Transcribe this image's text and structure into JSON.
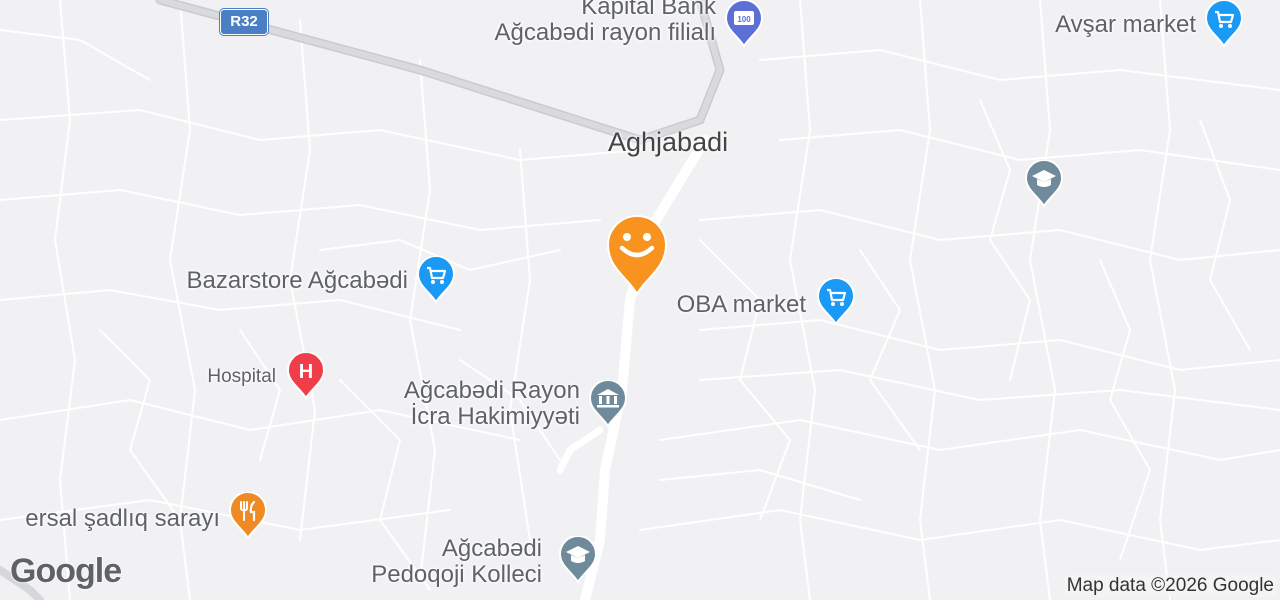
{
  "map": {
    "city_label": "Aghjabadi",
    "road_shield": "R32",
    "attribution": "Map data ©2026 Google",
    "logo": "Google",
    "places": [
      {
        "id": "kapital",
        "lines": [
          "Kapital Bank",
          "Ağcabədi rayon filialı"
        ],
        "icon": "atm-icon",
        "color": "#5b6fd6"
      },
      {
        "id": "avsar",
        "lines": [
          "Avşar market"
        ],
        "icon": "shopping-cart-icon",
        "color": "#1a9af5"
      },
      {
        "id": "bazarstore",
        "lines": [
          "Bazarstore Ağcabədi"
        ],
        "icon": "shopping-cart-icon",
        "color": "#1a9af5"
      },
      {
        "id": "oba",
        "lines": [
          "OBA market"
        ],
        "icon": "shopping-cart-icon",
        "color": "#1a9af5"
      },
      {
        "id": "hospital",
        "lines": [
          "Hospital"
        ],
        "icon": "hospital-icon",
        "color": "#ef3e4a"
      },
      {
        "id": "hakimiyyeti",
        "lines": [
          "Ağcabədi Rayon",
          "İcra Hakimiyyəti"
        ],
        "icon": "government-building-icon",
        "color": "#6f8a9a"
      },
      {
        "id": "sadliq",
        "lines": [
          "ersal şadlıq sarayı"
        ],
        "icon": "restaurant-icon",
        "color": "#f08a24"
      },
      {
        "id": "kolleci",
        "lines": [
          "Ağcabədi",
          "Pedoqoji Kolleci"
        ],
        "icon": "school-icon",
        "color": "#6f8a9a"
      },
      {
        "id": "school_ne",
        "lines": [],
        "icon": "school-icon",
        "color": "#6f8a9a"
      }
    ],
    "current_location_color": "#f7931e"
  }
}
